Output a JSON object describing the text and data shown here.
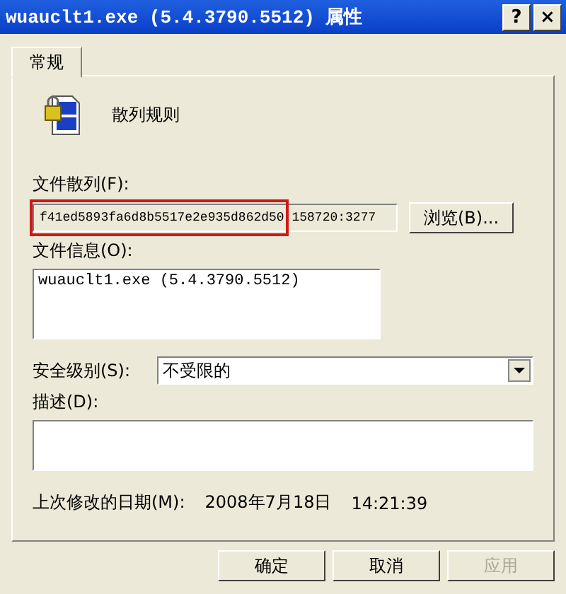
{
  "window": {
    "title": "wuauclt1.exe (5.4.3790.5512) 属性",
    "help_button": "?",
    "close_button": "×"
  },
  "tabs": [
    {
      "label": "常规",
      "selected": true
    }
  ],
  "rule": {
    "name": "散列规则"
  },
  "file_hash": {
    "label": "文件散列(F):",
    "value": "f41ed5893fa6d8b5517e2e935d862d50:158720:3277",
    "highlighted": true,
    "browse_button": "浏览(B)..."
  },
  "file_info": {
    "label": "文件信息(O):",
    "value": "wuauclt1.exe (5.4.3790.5512)"
  },
  "security_level": {
    "label": "安全级别(S):",
    "value": "不受限的"
  },
  "description": {
    "label": "描述(D):"
  },
  "modified": {
    "label": "上次修改的日期(M):",
    "date": "2008年7月18日",
    "time": "14:21:39"
  },
  "buttons": [
    {
      "label": "确定",
      "disabled": false
    },
    {
      "label": "取消",
      "disabled": false
    },
    {
      "label": "应用",
      "disabled": true
    }
  ]
}
